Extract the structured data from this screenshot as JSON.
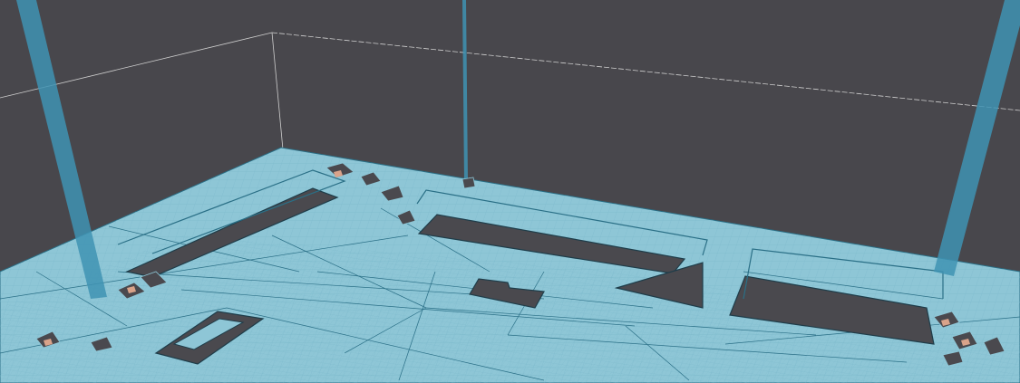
{
  "viewport": {
    "colors": {
      "background": "#48474c",
      "navmesh_fill": "#8ec6d6",
      "navmesh_edge": "#2a6f86",
      "navmesh_grid": "#6fb0c4",
      "obstacle": "#4a494e",
      "obstacle_outline": "#1e3d4a",
      "debris_orange": "#d9a38a",
      "bounds_line": "#cfcfcf",
      "pillar": "#3f93b3"
    },
    "icons": [
      "navmesh-surface",
      "bounds-box",
      "pillar",
      "obstacle",
      "debris"
    ]
  }
}
